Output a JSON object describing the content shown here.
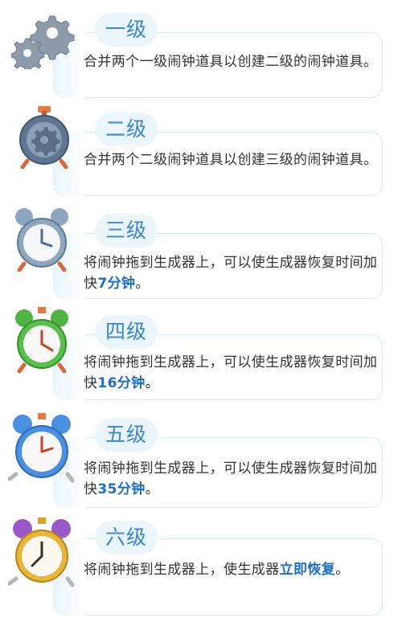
{
  "items": [
    {
      "level": "一级",
      "text": "合并两个一级闹钟道具以创建二级的闹钟道具。",
      "icon": "gears-icon"
    },
    {
      "level": "二级",
      "text": "合并两个二级闹钟道具以创建三级的闹钟道具。",
      "icon": "gear-clock-icon"
    },
    {
      "level": "三级",
      "prefix": "将闹钟拖到生成器上，可以使生成器恢复时间加快",
      "highlight": "7分钟",
      "suffix": "。",
      "icon": "alarm-clock-silver-icon",
      "color": "#9bb4cf"
    },
    {
      "level": "四级",
      "prefix": "将闹钟拖到生成器上，可以使生成器恢复时间加快",
      "highlight": "16分钟",
      "suffix": "。",
      "icon": "alarm-clock-green-icon",
      "color": "#57c04c"
    },
    {
      "level": "五级",
      "prefix": "将闹钟拖到生成器上，可以使生成器恢复时间加快",
      "highlight": "35分钟",
      "suffix": "。",
      "icon": "alarm-clock-blue-icon",
      "color": "#4a8fe0"
    },
    {
      "level": "六级",
      "prefix": "将闹钟拖到生成器上，使生成器",
      "highlight": "立即恢复",
      "suffix": "。",
      "icon": "alarm-clock-gold-icon",
      "color": "#e8b53a"
    }
  ],
  "colors": {
    "accent": "#3d87c9",
    "highlight": "#1f6fc0",
    "card_border": "#d6ecf7",
    "pill_bg": "#eaf5fc"
  }
}
